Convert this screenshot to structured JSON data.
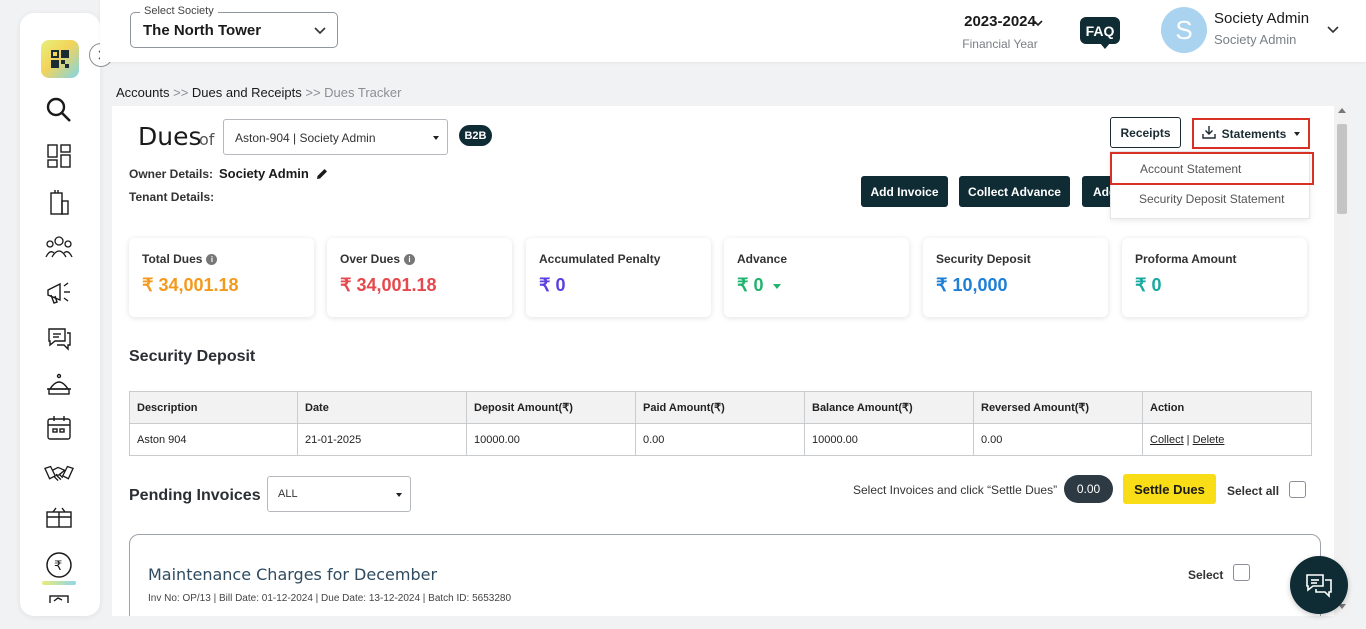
{
  "header": {
    "society_label": "Select Society",
    "society_value": "The North Tower",
    "fy_year": "2023-2024",
    "fy_label": "Financial Year",
    "faq": "FAQ",
    "avatar_letter": "S",
    "user_name": "Society Admin",
    "user_role": "Society Admin"
  },
  "breadcrumb": {
    "item1": "Accounts",
    "sep1": " >> ",
    "item2": "Dues and Receipts",
    "sep2": " >> ",
    "current": "Dues Tracker"
  },
  "dues": {
    "title": "Dues",
    "of": "of",
    "unit_select": "Aston-904 | Society Admin",
    "badge": "B2B",
    "owner_label": "Owner Details:",
    "owner_value": "Society Admin",
    "tenant_label": "Tenant Details:"
  },
  "actions": {
    "receipts": "Receipts",
    "statements": "Statements",
    "add_invoice": "Add Invoice",
    "collect_advance": "Collect Advance",
    "add_more": "Add",
    "dropdown": [
      "Account Statement",
      "Security Deposit Statement"
    ]
  },
  "stats": [
    {
      "title": "Total Dues",
      "value": "₹ 34,001.18",
      "color": "#f39a1e"
    },
    {
      "title": "Over Dues",
      "value": "₹ 34,001.18",
      "color": "#e5484d"
    },
    {
      "title": "Accumulated Penalty",
      "value": "₹ 0",
      "color": "#5b3fe0"
    },
    {
      "title": "Advance",
      "value": "₹ 0",
      "color": "#1fb36d"
    },
    {
      "title": "Security Deposit",
      "value": "₹ 10,000",
      "color": "#1e7fd6"
    },
    {
      "title": "Proforma Amount",
      "value": "₹ 0",
      "color": "#19a9a0"
    }
  ],
  "security_deposit": {
    "title": "Security Deposit",
    "headers": [
      "Description",
      "Date",
      "Deposit Amount(₹)",
      "Paid Amount(₹)",
      "Balance Amount(₹)",
      "Reversed Amount(₹)",
      "Action"
    ],
    "row": [
      "Aston 904",
      "21-01-2025",
      "10000.00",
      "0.00",
      "10000.00",
      "0.00"
    ],
    "action_collect": "Collect",
    "action_sep": " | ",
    "action_delete": "Delete"
  },
  "pending": {
    "title": "Pending Invoices",
    "filter": "ALL",
    "hint": "Select Invoices and click “Settle Dues”",
    "amount": "0.00",
    "settle": "Settle Dues",
    "select_all": "Select all"
  },
  "invoice": {
    "title": "Maintenance Charges for December",
    "meta": "Inv No: OP/13 | Bill Date: 01-12-2024 | Due Date: 13-12-2024 | Batch ID: 5653280",
    "select": "Select"
  }
}
